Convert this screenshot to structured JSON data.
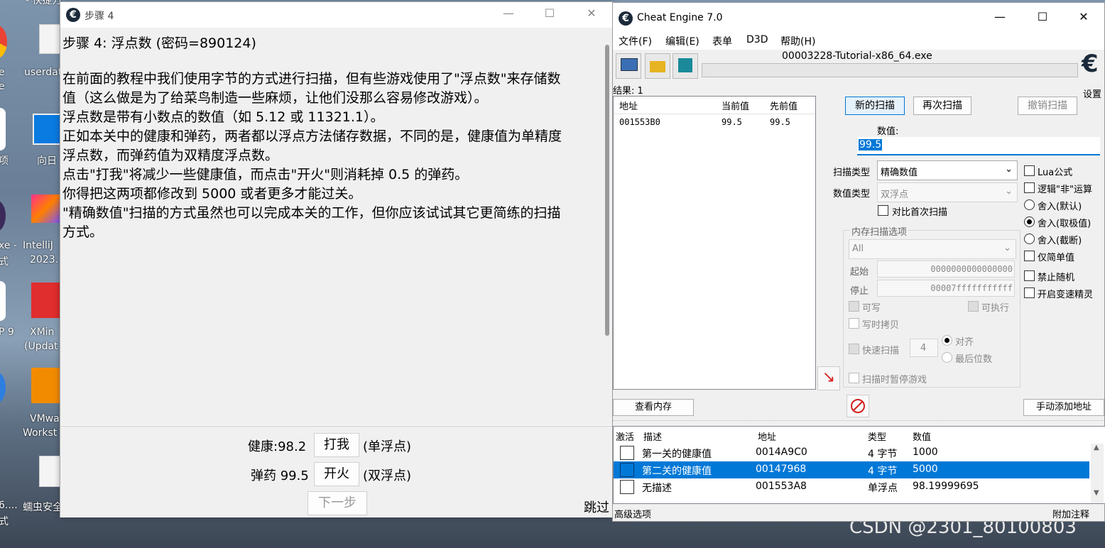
{
  "desktop": {
    "icons": [
      {
        "label": "e",
        "label2": "e"
      },
      {
        "label": "userdat"
      },
      {
        "label": "项"
      },
      {
        "label": "向日"
      },
      {
        "label": "xe -",
        "label2": "式"
      },
      {
        "label": "IntelliJ",
        "label2": "2023."
      },
      {
        "label": "P 9"
      },
      {
        "label": "XMin",
        "label2": "(Updat"
      },
      {
        "label": "VMwa",
        "label2": "Workst"
      },
      {
        "label": "6....",
        "label2": "式"
      },
      {
        "label": "蠕虫安全"
      }
    ],
    "top_label": "- 快捷方",
    "watermark": "CSDN @2301_80100803"
  },
  "tutorial": {
    "title": "步骤 4",
    "heading": "步骤 4: 浮点数 (密码=890124)",
    "lines": [
      "在前面的教程中我们使用字节的方式进行扫描，但有些游戏使用了\"浮点数\"来存储数",
      "值（这么做是为了给菜鸟制造一些麻烦，让他们没那么容易修改游戏）。",
      "浮点数是带有小数点的数值（如 5.12 或 11321.1）。",
      "正如本关中的健康和弹药，两者都以浮点方法储存数据，不同的是，健康值为单精度",
      "浮点数，而弹药值为双精度浮点数。",
      "点击\"打我\"将减少一些健康值，而点击\"开火\"则消耗掉 0.5 的弹药。",
      "你得把这两项都修改到 5000 或者更多才能过关。",
      "\"精确数值\"扫描的方式虽然也可以完成本关的工作，但你应该试试其它更简练的扫描",
      "方式。"
    ],
    "health_label": "健康:98.2",
    "hit_button": "打我",
    "health_type": "(单浮点)",
    "ammo_label": "弹药 99.5",
    "fire_button": "开火",
    "ammo_type": "(双浮点)",
    "next_button": "下一步",
    "skip_label": "跳过"
  },
  "ce": {
    "title": "Cheat Engine 7.0",
    "menu": [
      "文件(F)",
      "编辑(E)",
      "表单",
      "D3D",
      "帮助(H)"
    ],
    "process": "00003228-Tutorial-x86_64.exe",
    "settings_label": "设置",
    "results_label": "结果: 1",
    "result_headers": [
      "地址",
      "当前值",
      "先前值"
    ],
    "results": [
      {
        "address": "001553B0",
        "current": "99.5",
        "previous": "99.5"
      }
    ],
    "new_scan": "新的扫描",
    "next_scan": "再次扫描",
    "undo_scan": "撤销扫描",
    "value_label": "数值:",
    "value": "99.5",
    "scan_type_label": "扫描类型",
    "scan_type": "精确数值",
    "value_type_label": "数值类型",
    "value_type": "双浮点",
    "compare_first": "对比首次扫描",
    "mem_options_label": "内存扫描选项",
    "mem_region": "All",
    "start_label": "起始",
    "start_value": "0000000000000000",
    "stop_label": "停止",
    "stop_value": "00007fffffffffff",
    "writable": "可写",
    "executable": "可执行",
    "copy_on_write": "写时拷贝",
    "fast_scan": "快速扫描",
    "fast_scan_value": "4",
    "align": "对齐",
    "last_digits": "最后位数",
    "pause_game": "扫描时暂停游戏",
    "right_options": [
      {
        "type": "checkbox",
        "label": "Lua公式",
        "on": false
      },
      {
        "type": "checkbox",
        "label": "逻辑\"非\"运算",
        "on": false
      },
      {
        "type": "radio",
        "label": "舍入(默认)",
        "on": false
      },
      {
        "type": "radio",
        "label": "舍入(取极值)",
        "on": true
      },
      {
        "type": "radio",
        "label": "舍入(截断)",
        "on": false
      },
      {
        "type": "checkbox",
        "label": "仅简单值",
        "on": false
      },
      {
        "type": "checkbox",
        "label": "禁止随机",
        "on": false
      },
      {
        "type": "checkbox",
        "label": "开启变速精灵",
        "on": false
      }
    ],
    "view_memory": "查看内存",
    "add_address": "手动添加地址",
    "table_headers": [
      "激活",
      "描述",
      "地址",
      "类型",
      "数值"
    ],
    "table_rows": [
      {
        "desc": "第一关的健康值",
        "address": "0014A9C0",
        "type": "4 字节",
        "value": "1000"
      },
      {
        "desc": "第二关的健康值",
        "address": "00147968",
        "type": "4 字节",
        "value": "5000"
      },
      {
        "desc": "无描述",
        "address": "001553A8",
        "type": "单浮点",
        "value": "98.19999695"
      }
    ],
    "advanced": "高级选项",
    "comments": "附加注释",
    "colors": {
      "selection": "#0078d7",
      "accent": "#005a9e"
    }
  }
}
